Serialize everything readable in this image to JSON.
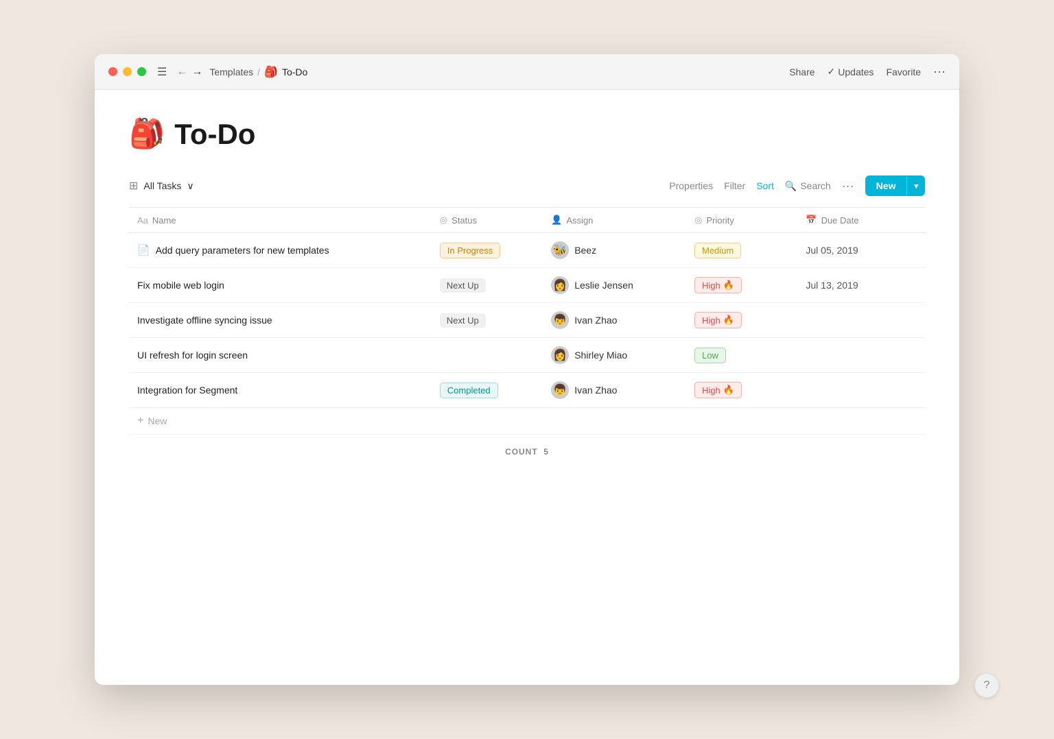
{
  "window": {
    "title": "To-Do",
    "breadcrumb_parent": "Templates",
    "breadcrumb_sep": "/",
    "page_icon": "🎒",
    "page_title": "To-Do"
  },
  "titlebar": {
    "share_label": "Share",
    "updates_check": "✓",
    "updates_label": "Updates",
    "favorite_label": "Favorite",
    "ellipsis": "···"
  },
  "toolbar": {
    "view_icon": "⊞",
    "view_label": "All Tasks",
    "chevron": "∨",
    "properties_label": "Properties",
    "filter_label": "Filter",
    "sort_label": "Sort",
    "search_icon": "🔍",
    "search_label": "Search",
    "more_label": "···",
    "new_label": "New",
    "new_caret": "▾"
  },
  "table": {
    "columns": [
      {
        "id": "name",
        "icon": "Aa",
        "label": "Name"
      },
      {
        "id": "status",
        "icon": "◎",
        "label": "Status"
      },
      {
        "id": "assign",
        "icon": "👤",
        "label": "Assign"
      },
      {
        "id": "priority",
        "icon": "◎",
        "label": "Priority"
      },
      {
        "id": "duedate",
        "icon": "📅",
        "label": "Due Date"
      }
    ],
    "rows": [
      {
        "name": "Add query parameters for new templates",
        "name_icon": "📄",
        "status": "In Progress",
        "status_type": "inprogress",
        "assignee": "Beez",
        "assignee_avatar": "🐝",
        "priority": "Medium",
        "priority_type": "medium",
        "priority_emoji": "",
        "due_date": "Jul 05, 2019"
      },
      {
        "name": "Fix mobile web login",
        "name_icon": "",
        "status": "Next Up",
        "status_type": "nextup",
        "assignee": "Leslie Jensen",
        "assignee_avatar": "👩",
        "priority": "High 🔥",
        "priority_type": "high",
        "priority_emoji": "🔥",
        "due_date": "Jul 13, 2019"
      },
      {
        "name": "Investigate offline syncing issue",
        "name_icon": "",
        "status": "Next Up",
        "status_type": "nextup",
        "assignee": "Ivan Zhao",
        "assignee_avatar": "👦",
        "priority": "High 🔥",
        "priority_type": "high",
        "priority_emoji": "🔥",
        "due_date": ""
      },
      {
        "name": "UI refresh for login screen",
        "name_icon": "",
        "status": "",
        "status_type": "",
        "assignee": "Shirley Miao",
        "assignee_avatar": "👩",
        "priority": "Low",
        "priority_type": "low",
        "priority_emoji": "",
        "due_date": ""
      },
      {
        "name": "Integration for Segment",
        "name_icon": "",
        "status": "Completed",
        "status_type": "completed",
        "assignee": "Ivan Zhao",
        "assignee_avatar": "👦",
        "priority": "High 🔥",
        "priority_type": "high",
        "priority_emoji": "🔥",
        "due_date": ""
      }
    ],
    "add_new_label": "New",
    "count_label": "COUNT",
    "count_value": "5"
  },
  "help_button": "?"
}
